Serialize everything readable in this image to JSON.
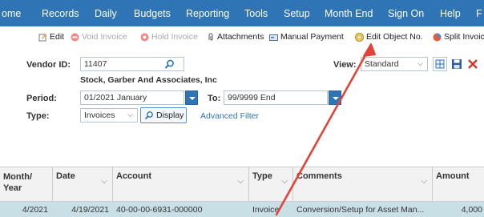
{
  "nav": [
    "ome",
    "Records",
    "Daily",
    "Budgets",
    "Reporting",
    "Tools",
    "Setup",
    "Month End",
    "Sign On",
    "Help",
    "F"
  ],
  "toolbar": {
    "edit": "Edit",
    "void_invoice": "Void Invoice",
    "hold_invoice": "Hold Invoice",
    "attachments": "Attachments",
    "manual_payment": "Manual Payment",
    "edit_object_no": "Edit Object No.",
    "split_invoice": "Split Invoice"
  },
  "form": {
    "vendor_id_label": "Vendor ID:",
    "vendor_id": "11407",
    "vendor_name": "Stock, Garber And Associates, Inc",
    "view_label": "View:",
    "view_value": "Standard",
    "period_label": "Period:",
    "period_from": "01/2021  January",
    "to_label": "To:",
    "period_to": "99/9999  End",
    "type_label": "Type:",
    "type_value": "Invoices",
    "display_button": "Display",
    "advanced_filter": "Advanced Filter"
  },
  "grid": {
    "headers": [
      "Month/ Year",
      "Date",
      "Account",
      "Type",
      "Comments",
      "Amount"
    ],
    "rows": [
      [
        "4/2021",
        "4/19/2021",
        "40-00-00-6931-000000",
        "Invoice",
        "Conversion/Setup for Asset Man...",
        "4,000"
      ]
    ]
  },
  "colors": {
    "nav_bg": "#2f74b5",
    "row_highlight": "#c9dfe6",
    "arrow": "#e0453a"
  }
}
